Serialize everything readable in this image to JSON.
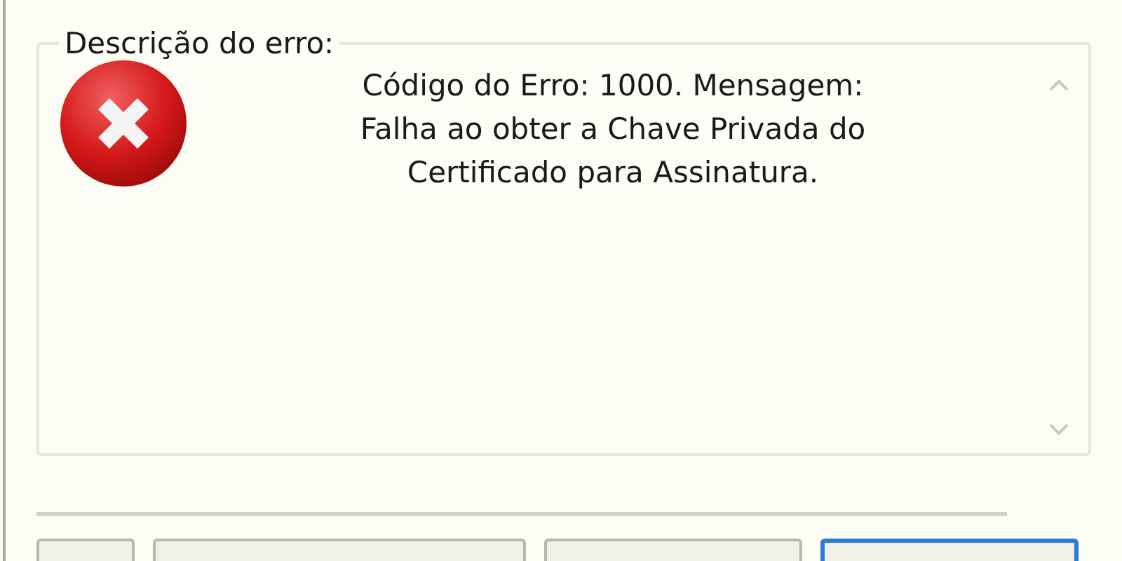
{
  "error_group": {
    "legend": "Descrição do erro:",
    "message_lines": [
      "Código do Erro: 1000. Mensagem:",
      "Falha ao obter a Chave Privada do",
      "Certificado para Assinatura."
    ]
  },
  "buttons": [
    {
      "default": false
    },
    {
      "default": false
    },
    {
      "default": false
    },
    {
      "default": true
    }
  ]
}
